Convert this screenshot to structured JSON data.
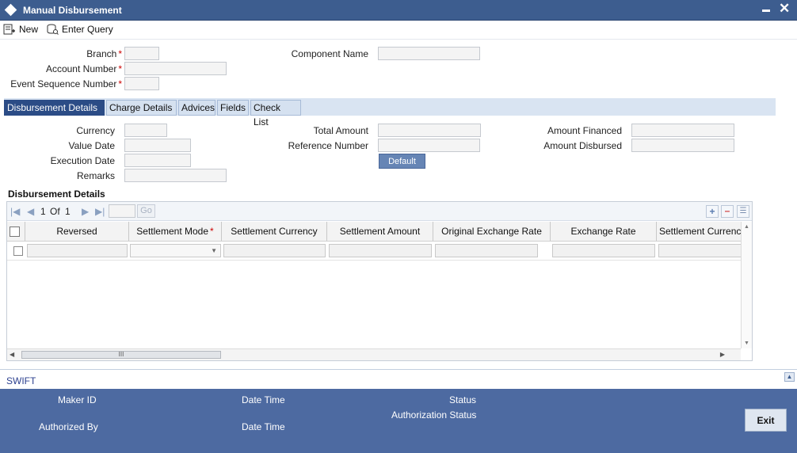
{
  "window": {
    "title": "Manual Disbursement"
  },
  "toolbar": {
    "new_label": "New",
    "enter_query_label": "Enter Query"
  },
  "header": {
    "branch_label": "Branch",
    "account_number_label": "Account Number",
    "event_sequence_label": "Event Sequence Number",
    "component_name_label": "Component Name",
    "required_mark": "*"
  },
  "tabs": [
    {
      "label": "Disbursement Details",
      "active": true
    },
    {
      "label": "Charge Details"
    },
    {
      "label": "Advices"
    },
    {
      "label": "Fields"
    },
    {
      "label": "Check List"
    }
  ],
  "details": {
    "currency_label": "Currency",
    "value_date_label": "Value Date",
    "execution_date_label": "Execution Date",
    "remarks_label": "Remarks",
    "total_amount_label": "Total Amount",
    "reference_number_label": "Reference Number",
    "amount_financed_label": "Amount Financed",
    "amount_disbursed_label": "Amount Disbursed",
    "default_button": "Default"
  },
  "grid": {
    "title": "Disbursement Details",
    "page_current": "1",
    "page_of": "Of",
    "page_total": "1",
    "go_label": "Go",
    "columns": [
      "Reversed",
      "Settlement Mode",
      "Settlement Currency",
      "Settlement Amount",
      "Original Exchange Rate",
      "Exchange Rate",
      "Settlement Currency"
    ],
    "scroll_grip": "III"
  },
  "swift": {
    "label": "SWIFT"
  },
  "footer": {
    "maker_id_label": "Maker ID",
    "date_time_label": "Date Time",
    "status_label": "Status",
    "authorization_status_label": "Authorization Status",
    "authorized_by_label": "Authorized By",
    "date_time_label_2": "Date Time",
    "exit_label": "Exit"
  },
  "colors": {
    "title_bar": "#3d5d8f",
    "footer": "#4d6aa1",
    "active_tab": "#2b4c86",
    "required": "#cc0000"
  }
}
